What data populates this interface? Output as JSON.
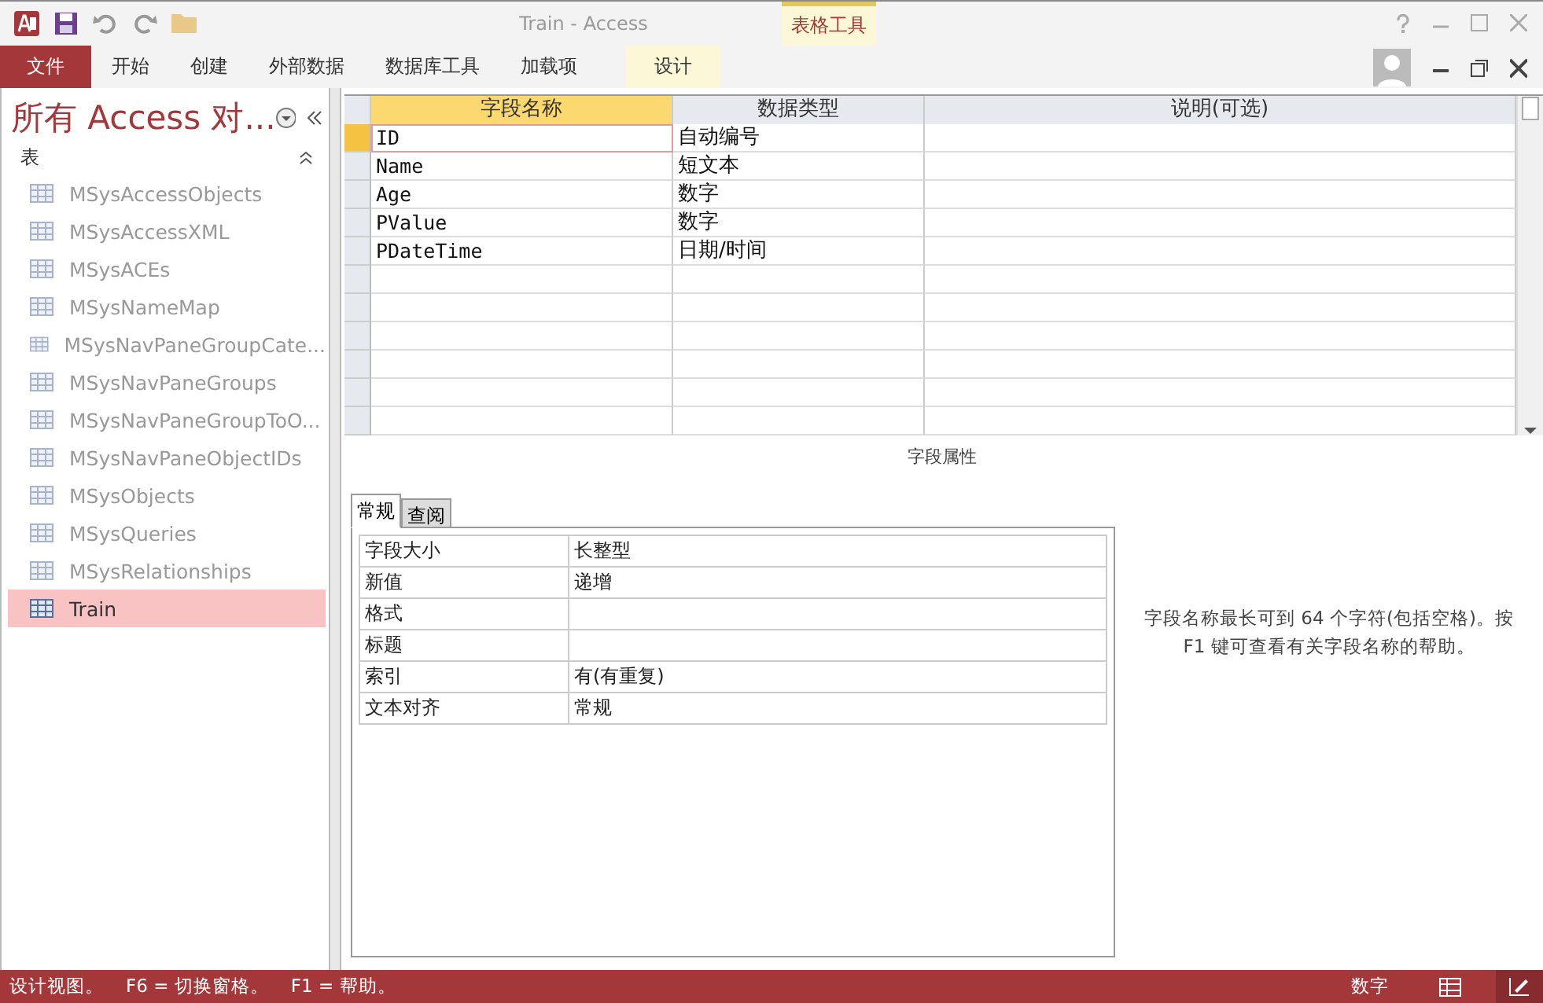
{
  "window": {
    "title": "Train - Access",
    "context_group": "表格工具"
  },
  "ribbon_tabs": [
    {
      "label": "文件",
      "kind": "file",
      "selected": false
    },
    {
      "label": "开始",
      "kind": "normal",
      "selected": false
    },
    {
      "label": "创建",
      "kind": "normal",
      "selected": false
    },
    {
      "label": "外部数据",
      "kind": "normal",
      "selected": false
    },
    {
      "label": "数据库工具",
      "kind": "normal",
      "selected": false
    },
    {
      "label": "加载项",
      "kind": "normal",
      "selected": false
    },
    {
      "label": "设计",
      "kind": "contextual",
      "selected": false
    }
  ],
  "nav_pane": {
    "title": "所有 Access 对...",
    "group": "表",
    "items": [
      {
        "label": "MSysAccessObjects",
        "selected": false
      },
      {
        "label": "MSysAccessXML",
        "selected": false
      },
      {
        "label": "MSysACEs",
        "selected": false
      },
      {
        "label": "MSysNameMap",
        "selected": false
      },
      {
        "label": "MSysNavPaneGroupCate...",
        "selected": false
      },
      {
        "label": "MSysNavPaneGroups",
        "selected": false
      },
      {
        "label": "MSysNavPaneGroupToO...",
        "selected": false
      },
      {
        "label": "MSysNavPaneObjectIDs",
        "selected": false
      },
      {
        "label": "MSysObjects",
        "selected": false
      },
      {
        "label": "MSysQueries",
        "selected": false
      },
      {
        "label": "MSysRelationships",
        "selected": false
      },
      {
        "label": "Train",
        "selected": true
      }
    ]
  },
  "design_grid": {
    "columns": [
      "字段名称",
      "数据类型",
      "说明(可选)"
    ],
    "rows": [
      {
        "name": "ID",
        "type": "自动编号",
        "selected": true
      },
      {
        "name": "Name",
        "type": "短文本",
        "selected": false
      },
      {
        "name": "Age",
        "type": "数字",
        "selected": false
      },
      {
        "name": "PValue",
        "type": "数字",
        "selected": false
      },
      {
        "name": "PDateTime",
        "type": "日期/时间",
        "selected": false
      }
    ]
  },
  "field_properties": {
    "title": "字段属性",
    "tabs": [
      {
        "label": "常规",
        "selected": true
      },
      {
        "label": "查阅",
        "selected": false
      }
    ],
    "rows": [
      {
        "label": "字段大小",
        "value": "长整型"
      },
      {
        "label": "新值",
        "value": "递增"
      },
      {
        "label": "格式",
        "value": ""
      },
      {
        "label": "标题",
        "value": ""
      },
      {
        "label": "索引",
        "value": "有(有重复)"
      },
      {
        "label": "文本对齐",
        "value": "常规"
      }
    ],
    "help": "字段名称最长可到 64 个字符(包括空格)。按 F1 键可查看有关字段名称的帮助。"
  },
  "status_bar": {
    "texts": [
      "设计视图。",
      "F6 = 切换窗格。",
      "F1 = 帮助。"
    ],
    "mode": "数字"
  }
}
